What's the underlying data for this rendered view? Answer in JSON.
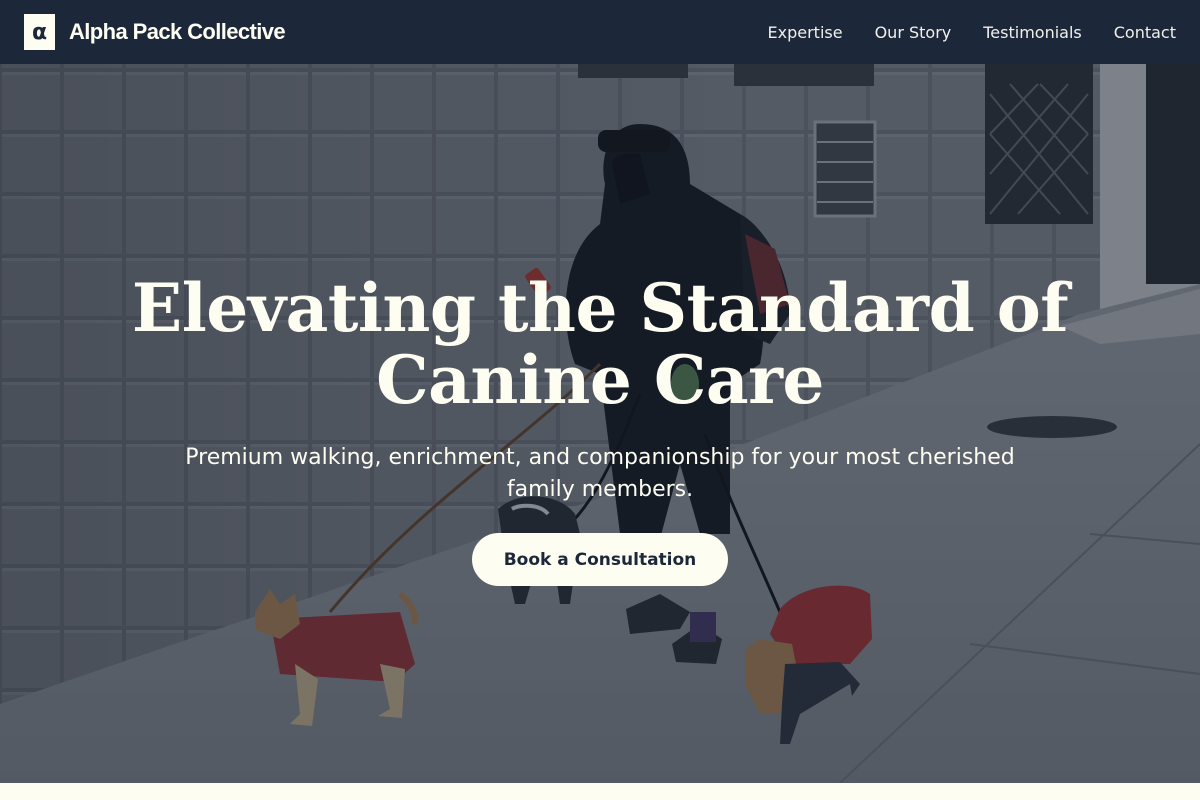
{
  "brand": {
    "logo_glyph": "α",
    "name": "Alpha Pack Collective"
  },
  "nav": {
    "items": [
      {
        "label": "Expertise"
      },
      {
        "label": "Our Story"
      },
      {
        "label": "Testimonials"
      },
      {
        "label": "Contact"
      }
    ]
  },
  "hero": {
    "title": "Elevating the Standard of Canine Care",
    "subtitle": "Premium walking, enrichment, and companionship for your most cherished family members.",
    "cta_label": "Book a Consultation"
  },
  "colors": {
    "header_bg": "#1d273a",
    "cream": "#fdfdf2",
    "overlay": "rgba(22, 32, 48, 0.48)"
  }
}
